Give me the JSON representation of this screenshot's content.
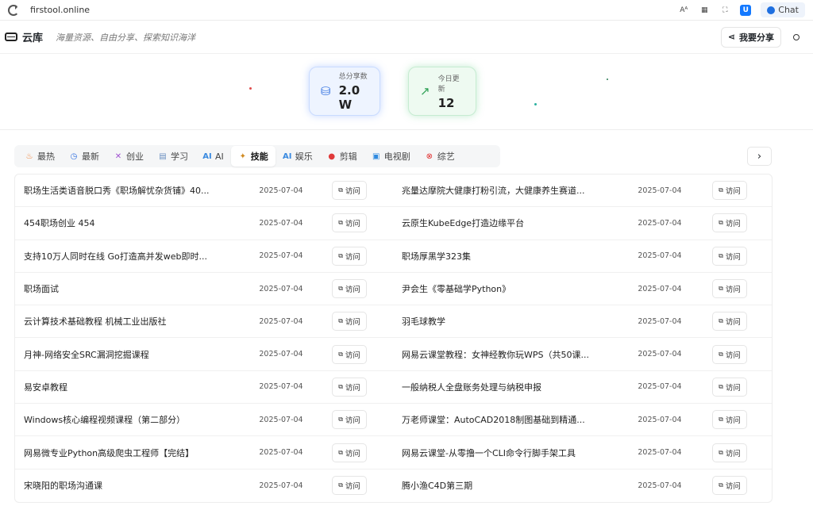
{
  "browser": {
    "url": "firstool.online",
    "chat_label": "Chat"
  },
  "header": {
    "site_name": "云库",
    "slogan": "海量资源、自由分享、探索知识海洋",
    "share_label": "我要分享"
  },
  "stats": [
    {
      "label": "总分享数",
      "value": "2.0 W"
    },
    {
      "label": "今日更新",
      "value": "12"
    }
  ],
  "tabs": [
    {
      "label": "最热",
      "icon": "fire-icon"
    },
    {
      "label": "最新",
      "icon": "clock-icon"
    },
    {
      "label": "创业",
      "icon": "rocket-icon"
    },
    {
      "label": "学习",
      "icon": "book-icon"
    },
    {
      "label": "AI",
      "icon": "ai-icon"
    },
    {
      "label": "技能",
      "icon": "tools-icon"
    },
    {
      "label": "娱乐",
      "icon": "ai-icon"
    },
    {
      "label": "剪辑",
      "icon": "scissors-icon"
    },
    {
      "label": "电视剧",
      "icon": "tv-icon"
    },
    {
      "label": "综艺",
      "icon": "record-icon"
    }
  ],
  "active_tab": "技能",
  "visit_label": "访问",
  "rows": [
    {
      "left_title": "职场生活类语音脱口秀《职场解忧杂货铺》40...",
      "left_date": "2025-07-04",
      "right_title": "兆量达摩院大健康打粉引流，大健康养生赛道...",
      "right_date": "2025-07-04"
    },
    {
      "left_title": "454职场创业 454",
      "left_date": "2025-07-04",
      "right_title": "云原生KubeEdge打造边缘平台",
      "right_date": "2025-07-04"
    },
    {
      "left_title": "支持10万人同时在线 Go打造高并发web即时...",
      "left_date": "2025-07-04",
      "right_title": "职场厚黑学323集",
      "right_date": "2025-07-04"
    },
    {
      "left_title": "职场面试",
      "left_date": "2025-07-04",
      "right_title": "尹会生《零基础学Python》",
      "right_date": "2025-07-04"
    },
    {
      "left_title": "云计算技术基础教程 机械工业出版社",
      "left_date": "2025-07-04",
      "right_title": "羽毛球教学",
      "right_date": "2025-07-04"
    },
    {
      "left_title": "月神-网络安全SRC漏洞挖掘课程",
      "left_date": "2025-07-04",
      "right_title": "网易云课堂教程：女神经教你玩WPS（共50课...",
      "right_date": "2025-07-04"
    },
    {
      "left_title": "易安卓教程",
      "left_date": "2025-07-04",
      "right_title": "一般纳税人全盘账务处理与纳税申报",
      "right_date": "2025-07-04"
    },
    {
      "left_title": "Windows核心编程视频课程（第二部分）",
      "left_date": "2025-07-04",
      "right_title": "万老师课堂：AutoCAD2018制图基础到精通...",
      "right_date": "2025-07-04"
    },
    {
      "left_title": "网易微专业Python高级爬虫工程师【完结】",
      "left_date": "2025-07-04",
      "right_title": "网易云课堂-从零撸一个CLI命令行脚手架工具",
      "right_date": "2025-07-04"
    },
    {
      "left_title": "宋晓阳的职场沟通课",
      "left_date": "2025-07-04",
      "right_title": "腾小渔C4D第三期",
      "right_date": "2025-07-04"
    }
  ]
}
